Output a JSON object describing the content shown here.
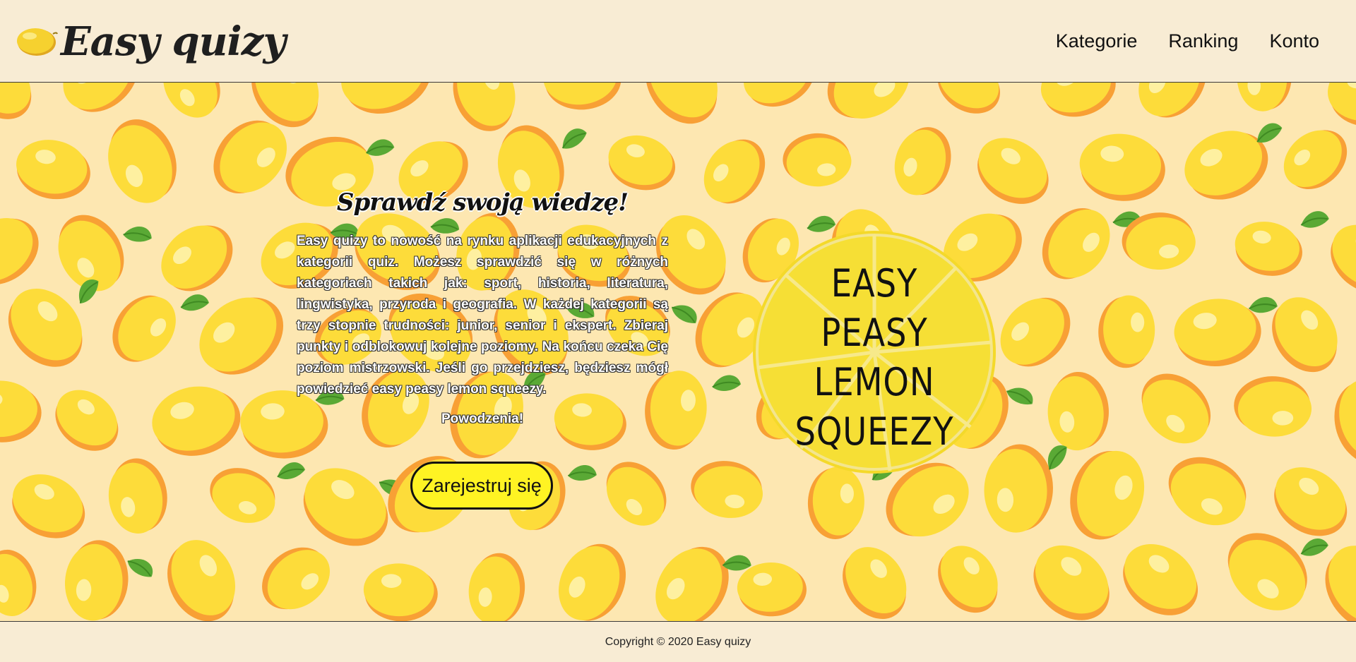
{
  "header": {
    "brand_name": "Easy quizy",
    "logo_icon": "lemon-icon",
    "nav": [
      "Kategorie",
      "Ranking",
      "Konto"
    ]
  },
  "hero": {
    "title": "Sprawdź swoją wiedzę!",
    "paragraph": "Easy quizy to nowość na rynku aplikacji edukacyjnych z kategorii quiz. Możesz sprawdzić się w różnych kategoriach takich jak: sport, historia, literatura, lingwistyka, przyroda i geografia. W każdej kategorii są trzy stopnie trudności: junior, senior i ekspert. Zbieraj punkty i odblokowuj kolejne poziomy. Na końcu czeka Cię poziom mistrzowski. Jeśli go przejdziesz, będziesz mógł powiedzieć easy peasy lemon squeezy.",
    "wish": "Powodzenia!",
    "register_label": "Zarejestruj się",
    "badge_lines": [
      "EASY",
      "PEASY",
      "LEMON",
      "SQUEEZY"
    ]
  },
  "footer": {
    "copyright": "Copyright © 2020 Easy quizy"
  },
  "colors": {
    "page_bg": "#f8ecd4",
    "hero_bg": "#fde7b1",
    "lemon": "#fddc3a",
    "lemon_shadow": "#f8a035",
    "leaf": "#5aa935",
    "button": "#fff323"
  }
}
